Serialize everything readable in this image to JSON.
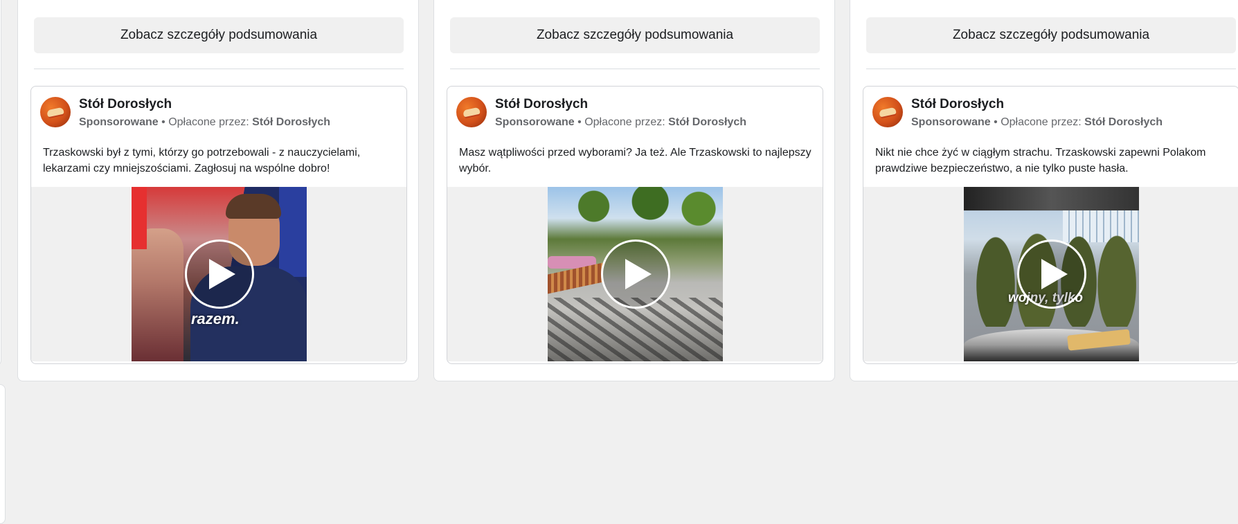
{
  "summary_button_label": "Zobacz szczegóły podsumowania",
  "ads": [
    {
      "page_name": "Stół Dorosłych",
      "sponsored_label": "Sponsorowane",
      "separator": " • ",
      "paid_by_prefix": "Opłacone przez: ",
      "paid_by_name": "Stół Dorosłych",
      "text": "Trzaskowski był z tymi, którzy go potrzebowali - z nauczycielami, lekarzami czy mniejszościami. Zagłosuj na wspólne dobro!",
      "video_overlay_text": "razem.",
      "media_icon": "play-icon"
    },
    {
      "page_name": "Stół Dorosłych",
      "sponsored_label": "Sponsorowane",
      "separator": " • ",
      "paid_by_prefix": "Opłacone przez: ",
      "paid_by_name": "Stół Dorosłych",
      "text": "Masz wątpliwości przed wyborami? Ja też. Ale Trzaskowski to najlepszy wybór.",
      "video_overlay_text": "",
      "media_icon": "play-icon"
    },
    {
      "page_name": "Stół Dorosłych",
      "sponsored_label": "Sponsorowane",
      "separator": " • ",
      "paid_by_prefix": "Opłacone przez: ",
      "paid_by_name": "Stół Dorosłych",
      "text": "Nikt nie chce żyć w ciągłym strachu. Trzaskowski zapewni Polakom prawdziwe bezpieczeństwo, a nie tylko puste hasła.",
      "video_overlay_text": "wojny, tylko",
      "media_icon": "play-icon"
    }
  ],
  "colors": {
    "page_background": "#f0f0f0",
    "card_background": "#ffffff",
    "button_background": "#f0f0f0",
    "primary_text": "#1c1e21",
    "secondary_text": "#65676b",
    "avatar_brand": "#d2501a"
  }
}
